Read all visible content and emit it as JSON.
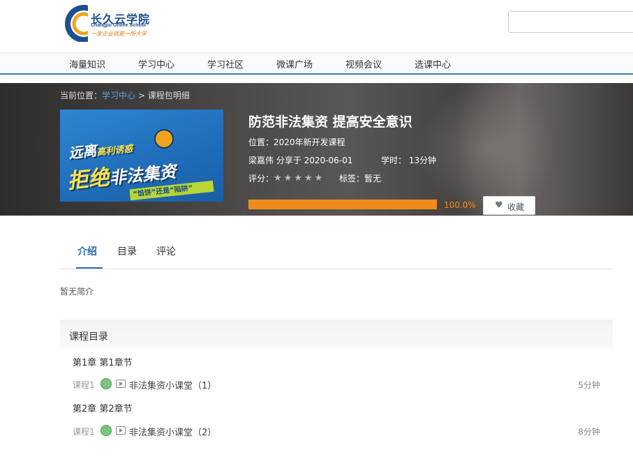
{
  "header": {
    "logo_title": "长久云学院",
    "logo_subtitle": "Changjiu Online School",
    "logo_slogan": "一家企业就是一所大学",
    "search_placeholder": ""
  },
  "nav": {
    "items": [
      "海量知识",
      "学习中心",
      "学习社区",
      "微课广场",
      "视频会议",
      "选课中心"
    ]
  },
  "breadcrumb": {
    "prefix": "当前位置：",
    "link": "学习中心",
    "separator": " > ",
    "current": "课程包明细"
  },
  "cover": {
    "line1_a": "远离",
    "line1_b": "高利诱惑",
    "line2_a": "拒绝",
    "line2_b": "非法集资",
    "line3": "“馅饼”还是“陷阱”"
  },
  "course": {
    "title": "防范非法集资 提高安全意识",
    "location": "位置：2020年新开发课程",
    "author_date": "梁嘉伟 分享于 2020-06-01",
    "hours_label": "学时：",
    "hours_value": "13分钟",
    "rating_label": "评分：",
    "rating_stars": 0,
    "rating_max": 5,
    "tags_label": "标签：",
    "tags_value": "暂无",
    "progress": 1.0,
    "progress_text": "100.0%",
    "favorite_label": "收藏"
  },
  "tabs": [
    "介绍",
    "目录",
    "评论"
  ],
  "active_tab": "介绍",
  "intro_text": "暂无简介",
  "catalog": {
    "title": "课程目录",
    "chapters": [
      {
        "title": "第1章  第1章节",
        "lessons": [
          {
            "num": "课程1",
            "name": "非法集资小课堂（1）",
            "duration": "5分钟"
          }
        ]
      },
      {
        "title": "第2章  第2章节",
        "lessons": [
          {
            "num": "课程1",
            "name": "非法集资小课堂（2）",
            "duration": "8分钟"
          }
        ]
      }
    ]
  },
  "colors": {
    "brand_blue": "#2d6fb5",
    "progress_orange": "#f08c1e",
    "status_green": "#7cc47f"
  }
}
